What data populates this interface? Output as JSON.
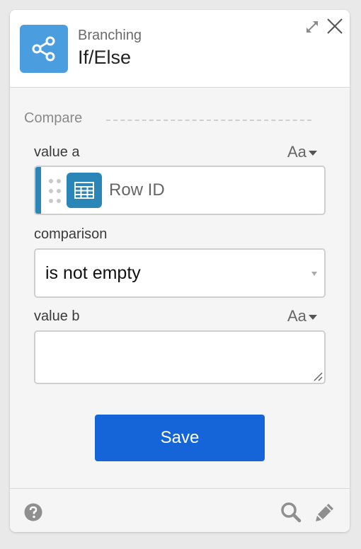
{
  "header": {
    "category": "Branching",
    "title": "If/Else",
    "icon": "share-icon",
    "accent_color": "#4a9ee0"
  },
  "section": {
    "label": "Compare"
  },
  "value_a": {
    "label": "value a",
    "format_toggle": "Aa",
    "token_label": "Row ID",
    "token_icon": "table-icon",
    "token_color": "#2b86b8"
  },
  "comparison": {
    "label": "comparison",
    "selected": "is not empty"
  },
  "value_b": {
    "label": "value b",
    "format_toggle": "Aa",
    "value": ""
  },
  "actions": {
    "save_label": "Save",
    "save_color": "#1565d8"
  },
  "footer": {
    "icons": [
      "help-icon",
      "search-icon",
      "pencil-icon"
    ]
  }
}
